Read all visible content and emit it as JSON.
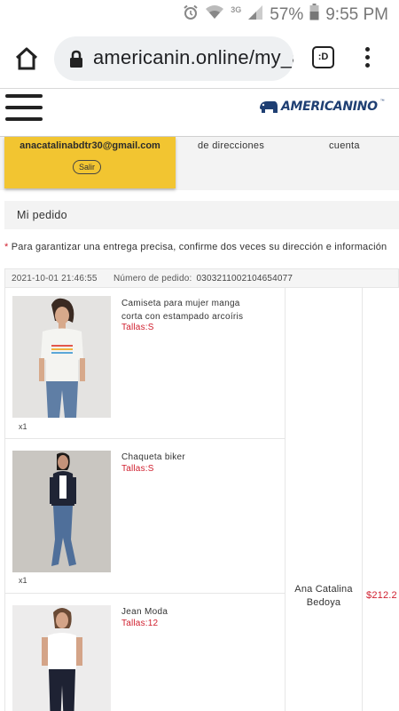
{
  "status_bar": {
    "network": "3G",
    "battery": "57%",
    "time": "9:55 PM"
  },
  "browser": {
    "url": "americanin.online/my_a",
    "tab_count": ":D"
  },
  "site": {
    "logo_text": "AMERICANINO",
    "logo_tm": "™"
  },
  "account_tabs": {
    "email": "anacatalinabdtr30@gmail.com",
    "logout_label": "Salir",
    "addresses_label": "de direcciones",
    "account_label": "cuenta"
  },
  "section_title": "Mi pedido",
  "notice": {
    "star": "*",
    "text": " Para garantizar una entrega precisa, confirme dos veces su dirección e información"
  },
  "order": {
    "date": "2021-10-01 21:46:55",
    "number_label": "Número de pedido:",
    "number": "0303211002104654077",
    "recipient": "Ana Catalina Bedoya",
    "total": "$212.2",
    "items": [
      {
        "name": "Camiseta para mujer manga corta con estampado arcoíris",
        "size": "Tallas:S",
        "qty": "x1"
      },
      {
        "name": "Chaqueta biker",
        "size": "Tallas:S",
        "qty": "x1"
      },
      {
        "name": "Jean Moda",
        "size": "Tallas:12",
        "qty": ""
      }
    ]
  },
  "colors": {
    "accent_yellow": "#f2c531",
    "price_red": "#d0202f",
    "brand_blue": "#1f3f73"
  }
}
